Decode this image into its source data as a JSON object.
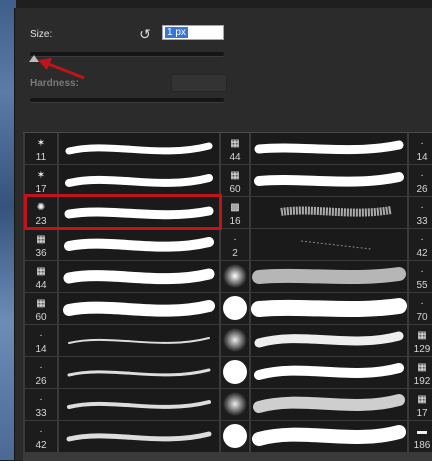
{
  "panel": {
    "size_label": "Size:",
    "size_value": "1 px",
    "hardness_label": "Hardness:",
    "reset_icon": "reset-icon"
  },
  "brush_numbers": {
    "col1": [
      "11",
      "17",
      "23",
      "36",
      "44",
      "60",
      "14",
      "26",
      "33",
      "42"
    ],
    "col2": [
      "44",
      "60",
      "16",
      "2",
      "",
      "",
      "",
      "",
      "",
      ""
    ],
    "col3": [
      "14",
      "26",
      "33",
      "42",
      "55",
      "70",
      "129",
      "192",
      "17",
      "186"
    ]
  },
  "annotation": {
    "arrow_color": "#c0141a",
    "highlight_color": "#c0141a"
  }
}
